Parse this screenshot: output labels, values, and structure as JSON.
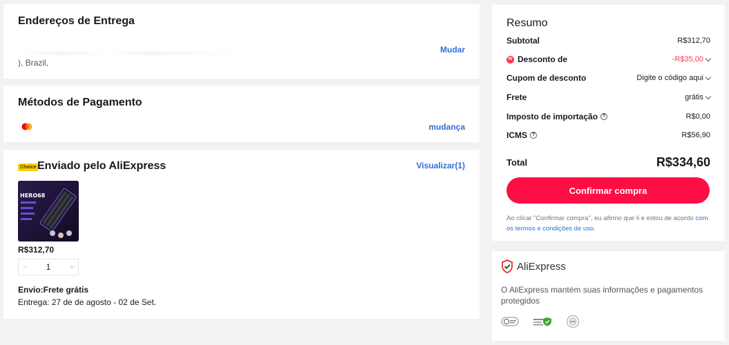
{
  "address": {
    "title": "Endereços de Entrega",
    "line": "), Brazil,",
    "change_label": "Mudar"
  },
  "payment": {
    "title": "Métodos de Pagamento",
    "change_label": "mudança",
    "card_icon": "mastercard-icon"
  },
  "shipping": {
    "badge": "Choice",
    "title": "Enviado pelo AliExpress",
    "view_label": "Visualizar(1)",
    "product": {
      "image_icon": "keyboard-product-image",
      "price": "R$312,70",
      "quantity": "1",
      "minus": "−",
      "plus": "+"
    },
    "delivery_title": "Envio:Frete grátis",
    "delivery_date": "Entrega: 27 de de agosto - 02 de Set."
  },
  "summary": {
    "title": "Resumo",
    "subtotal_label": "Subtotal",
    "subtotal_value": "R$312,70",
    "discount_label": "Desconto de",
    "discount_value": "-R$35,00",
    "coupon_label": "Cupom de desconto",
    "coupon_value": "Digite o código aqui",
    "freight_label": "Frete",
    "freight_value": "grátis",
    "import_tax_label": "Imposto de importação",
    "import_tax_value": "R$0,00",
    "icms_label": "ICMS",
    "icms_value": "R$56,90",
    "total_label": "Total",
    "total_value": "R$334,60",
    "confirm_label": "Confirmar compra",
    "terms_text": "Ao clicar \"Confirmar compra\", eu afirmo que li e estou de acordo ",
    "terms_link": "com os termos e condições de uso",
    "terms_end": ".",
    "accent_color": "#fd0e45",
    "discount_color": "#fd384f"
  },
  "trust": {
    "brand": "AliExpress",
    "description": "O AliExpress mantém suas informações e pagamentos protegidos",
    "badges": [
      "security-badge-icon",
      "verified-shield-icon",
      "certification-seal-icon"
    ]
  }
}
